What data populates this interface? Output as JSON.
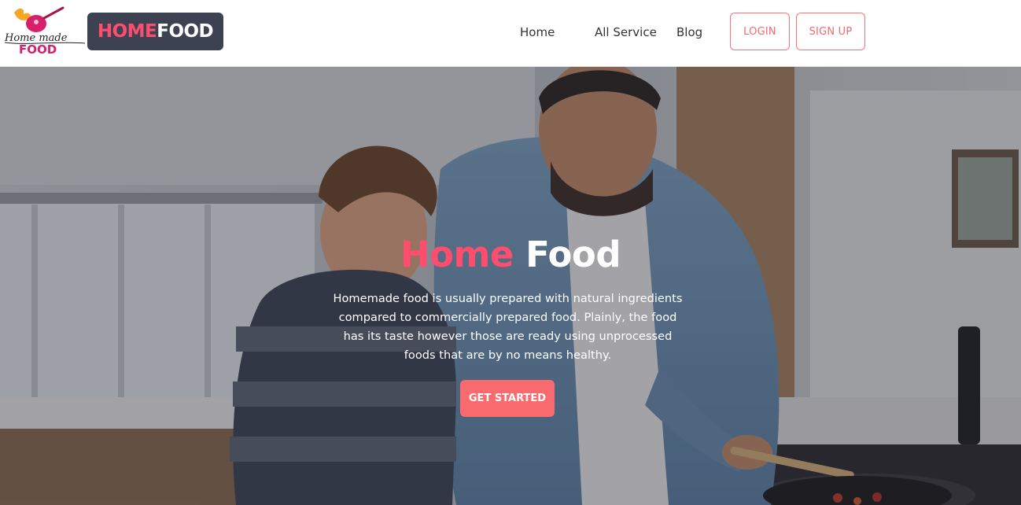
{
  "brand": {
    "logo_icon": "homemade-food-logo",
    "logo_script_text": "Home made",
    "logo_food_text": "FOOD",
    "name_part1": "HOME",
    "name_part2": "FOOD"
  },
  "nav": {
    "items": [
      {
        "label": "Home"
      },
      {
        "label": "All Service"
      },
      {
        "label": "Blog"
      }
    ],
    "login_label": "LOGIN",
    "signup_label": "SIGN UP"
  },
  "hero": {
    "title_part1": "Home",
    "title_part2": "Food",
    "description": "Homemade food is usually prepared with natural ingredients compared to commercially prepared food. Plainly, the food has its taste however those are ready using unprocessed foods that are by no means healthy.",
    "cta_label": "GET STARTED",
    "background_image": "father-and-son-cooking-in-kitchen"
  },
  "colors": {
    "accent_pink": "#ff4d6d",
    "button_coral": "#fa6b70",
    "brand_pill": "#3d4252"
  }
}
